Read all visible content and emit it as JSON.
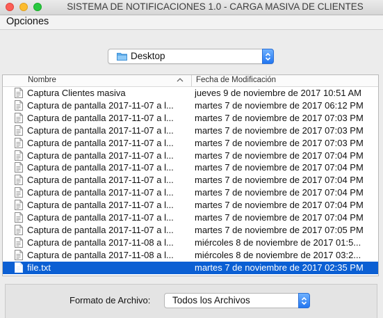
{
  "window": {
    "title": "SISTEMA DE NOTIFICACIONES 1.0 - CARGA MASIVA DE CLIENTES"
  },
  "menu": {
    "opciones": "Opciones"
  },
  "location": {
    "folder": "Desktop",
    "icon": "folder-icon"
  },
  "columns": {
    "name": "Nombre",
    "modified": "Fecha de Modificación",
    "sort_icon": "chevron-up-icon"
  },
  "files": [
    {
      "name": "Captura Clientes masiva",
      "date": "jueves 9 de noviembre de 2017 10:51 AM"
    },
    {
      "name": "Captura de pantalla 2017-11-07 a l...",
      "date": "martes 7 de noviembre de 2017 06:12 PM"
    },
    {
      "name": "Captura de pantalla 2017-11-07 a l...",
      "date": "martes 7 de noviembre de 2017 07:03 PM"
    },
    {
      "name": "Captura de pantalla 2017-11-07 a l...",
      "date": "martes 7 de noviembre de 2017 07:03 PM"
    },
    {
      "name": "Captura de pantalla 2017-11-07 a l...",
      "date": "martes 7 de noviembre de 2017 07:03 PM"
    },
    {
      "name": "Captura de pantalla 2017-11-07 a l...",
      "date": "martes 7 de noviembre de 2017 07:04 PM"
    },
    {
      "name": "Captura de pantalla 2017-11-07 a l...",
      "date": "martes 7 de noviembre de 2017 07:04 PM"
    },
    {
      "name": "Captura de pantalla 2017-11-07 a l...",
      "date": "martes 7 de noviembre de 2017 07:04 PM"
    },
    {
      "name": "Captura de pantalla 2017-11-07 a l...",
      "date": "martes 7 de noviembre de 2017 07:04 PM"
    },
    {
      "name": "Captura de pantalla 2017-11-07 a l...",
      "date": "martes 7 de noviembre de 2017 07:04 PM"
    },
    {
      "name": "Captura de pantalla 2017-11-07 a l...",
      "date": "martes 7 de noviembre de 2017 07:04 PM"
    },
    {
      "name": "Captura de pantalla 2017-11-07 a l...",
      "date": "martes 7 de noviembre de 2017 07:05 PM"
    },
    {
      "name": "Captura de pantalla 2017-11-08 a l...",
      "date": "miércoles 8 de noviembre de 2017 01:5..."
    },
    {
      "name": "Captura de pantalla 2017-11-08 a l...",
      "date": "miércoles 8 de noviembre de 2017 03:2..."
    },
    {
      "name": "file.txt",
      "date": "martes 7 de noviembre de 2017 02:35 PM",
      "selected": true
    }
  ],
  "format": {
    "label": "Formato de Archivo:",
    "value": "Todos los Archivos"
  },
  "colors": {
    "selection": "#0b5fd3",
    "accent": "#2276f0"
  }
}
